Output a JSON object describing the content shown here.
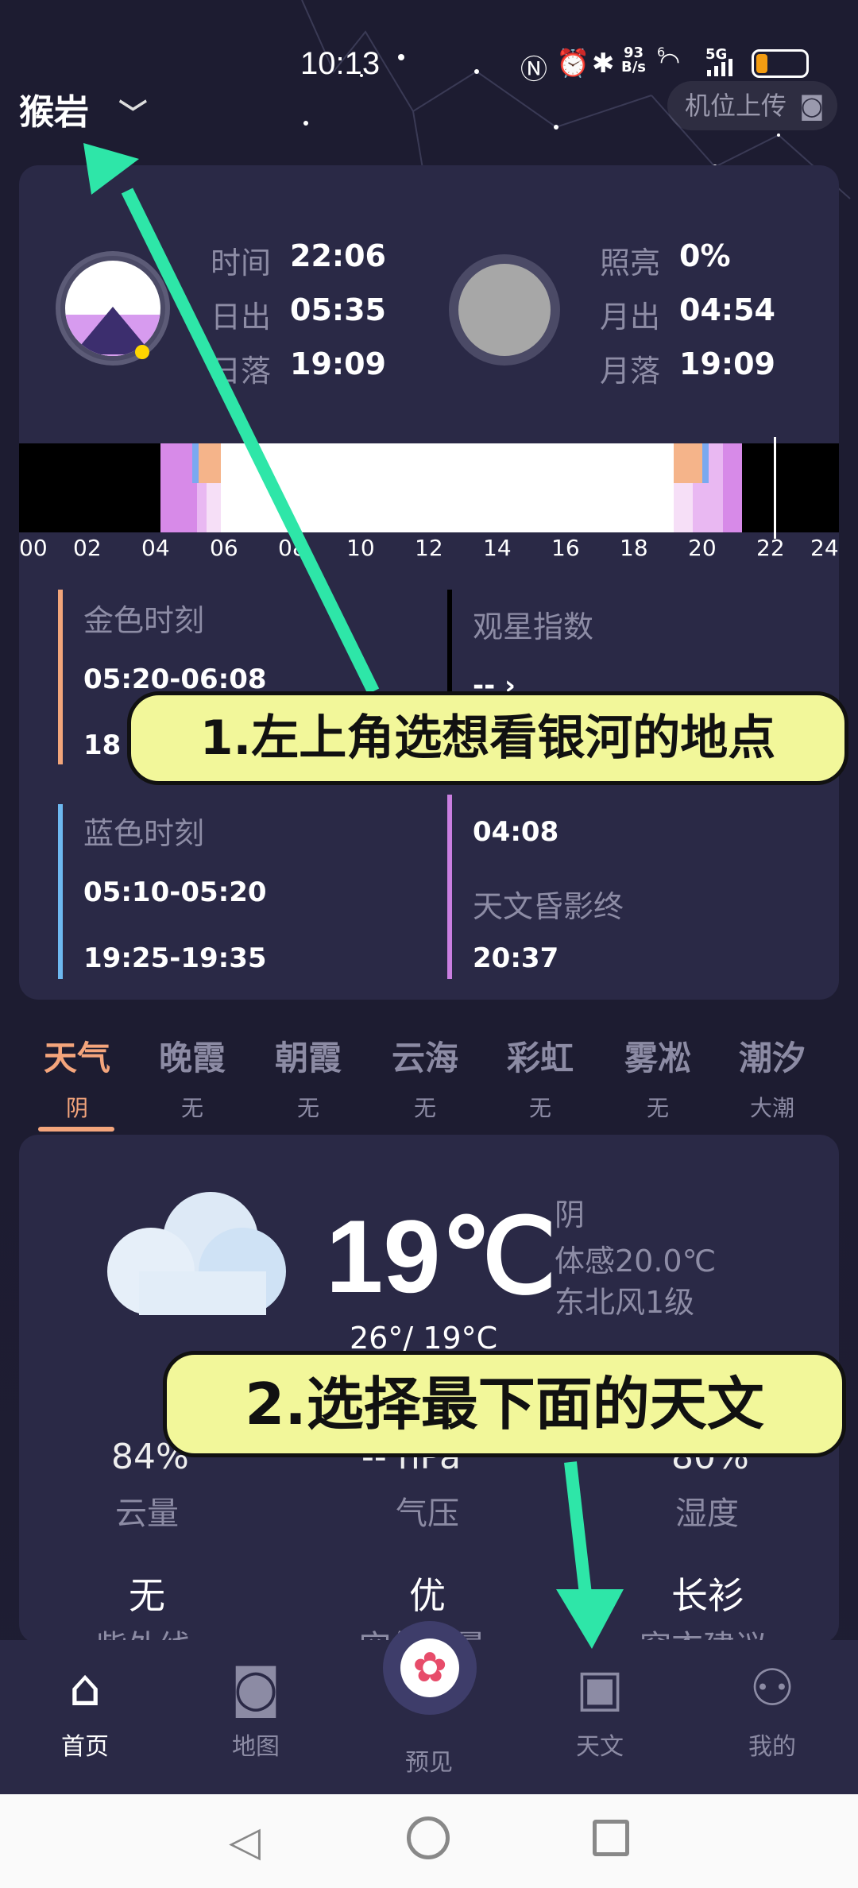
{
  "status": {
    "time": "10:13",
    "net_speed_top": "93",
    "net_speed_bottom": "B/s",
    "signal": "6",
    "sim": "5G"
  },
  "header": {
    "location": "猴岩",
    "upload": "机位上传"
  },
  "sun": {
    "time_label": "时间",
    "time": "22:06",
    "sunrise_label": "日出",
    "sunrise": "05:35",
    "sunset_label": "日落",
    "sunset": "19:09"
  },
  "moon": {
    "illum_label": "照亮",
    "illum": "0%",
    "moonrise_label": "月出",
    "moonrise": "04:54",
    "moonset_label": "月落",
    "moonset": "19:09"
  },
  "timeline": {
    "ticks": [
      "00",
      "02",
      "04",
      "06",
      "08",
      "10",
      "12",
      "14",
      "16",
      "18",
      "20",
      "22",
      "24"
    ],
    "current_hour": 22.1
  },
  "moments": {
    "golden_label": "金色时刻",
    "golden_1": "05:20-06:08",
    "golden_2": "18",
    "blue_label": "蓝色时刻",
    "blue_1": "05:10-05:20",
    "blue_2": "19:25-19:35",
    "star_label": "观星指数",
    "star_value": "-- ›",
    "astro_begin_value": "04:08",
    "astro_end_label": "天文昏影终",
    "astro_end": "20:37"
  },
  "tabs": [
    {
      "title": "天气",
      "sub": "阴"
    },
    {
      "title": "晚霞",
      "sub": "无"
    },
    {
      "title": "朝霞",
      "sub": "无"
    },
    {
      "title": "云海",
      "sub": "无"
    },
    {
      "title": "彩虹",
      "sub": "无"
    },
    {
      "title": "雾凇",
      "sub": "无"
    },
    {
      "title": "潮汐",
      "sub": "大潮"
    }
  ],
  "weather": {
    "temp": "19℃",
    "cond": "阴",
    "feels": "体感20.0℃",
    "wind": "东北风1级",
    "range": "26°/ 19°C",
    "cloud": "84%",
    "cloud_label": "云量",
    "pressure": "-- hPa",
    "pressure_label": "气压",
    "humidity": "80%",
    "humidity_label": "湿度",
    "uv": "无",
    "uv_label": "紫外线",
    "aq": "优",
    "aq_label": "空气质量",
    "dress": "长衫",
    "dress_label": "穿衣建议"
  },
  "annotations": {
    "note1": "1.左上角选想看银河的地点",
    "note2": "2.选择最下面的天文"
  },
  "nav": [
    {
      "label": "首页"
    },
    {
      "label": "地图"
    },
    {
      "label": "预见"
    },
    {
      "label": "天文"
    },
    {
      "label": "我的"
    }
  ],
  "colors": {
    "accent": "#f4a57c",
    "golden": "#f2a57a",
    "blue": "#6db8f0",
    "purple": "#c97ee0",
    "bubble": "#f2f79a",
    "arrow": "#2ee6a8"
  }
}
